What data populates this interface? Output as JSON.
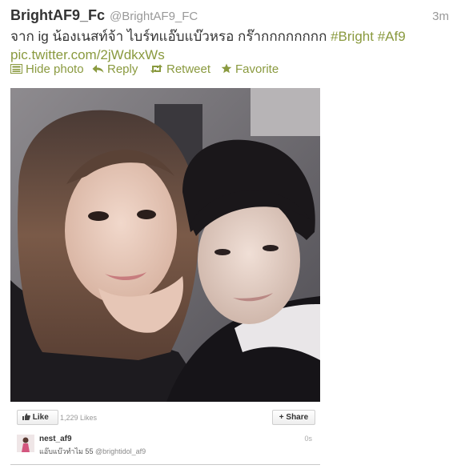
{
  "tweet": {
    "display_name": "BrightAF9_Fc",
    "handle": "@BrightAF9_FC",
    "timestamp": "3m",
    "text_thai": "จาก ig น้องเนสท์จ้า ไบร์ทแอ๊บแบ๊วหรอ กร๊ากกกกกกกก ",
    "hashtag1": "#Bright",
    "hashtag2": "#Af9",
    "pic_link": "pic.twitter.com/2jWdkxWs"
  },
  "actions": {
    "hide_photo": "Hide photo",
    "reply": "Reply",
    "retweet": "Retweet",
    "favorite": "Favorite"
  },
  "embed": {
    "like_label": "Like",
    "like_count": "1,229 Likes",
    "share_label": "Share",
    "comment_user": "nest_af9",
    "comment_text": "แอ๊บแบ๊วทำไม 55 ",
    "comment_mention": "@brightidol_af9",
    "comment_time": "0s"
  },
  "colors": {
    "link": "#8a9a3f",
    "name": "#333333",
    "meta": "#999999"
  },
  "icons": [
    "photo-icon",
    "reply-icon",
    "retweet-icon",
    "favorite-icon",
    "thumbs-up-icon",
    "plus-icon"
  ]
}
